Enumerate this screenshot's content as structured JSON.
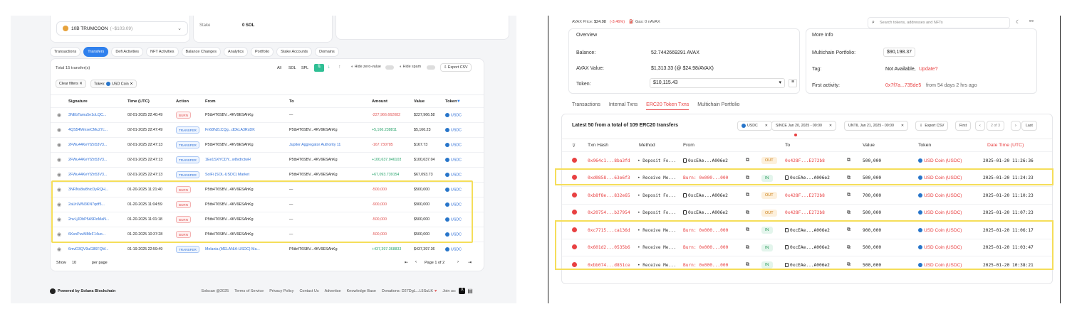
{
  "left": {
    "token_select": {
      "name": "10B TRUMCOON",
      "value": "(~$103.09)"
    },
    "stake": {
      "label": "Stake",
      "value": "0 SOL"
    },
    "tabs": [
      "Transactions",
      "Transfers",
      "Defi Activities",
      "NFT Activities",
      "Balance Changes",
      "Analytics",
      "Portfolio",
      "Stake Accounts",
      "Domains"
    ],
    "total": "Total 15 transfer(s)",
    "filters": [
      "All",
      "SOL",
      "SPL"
    ],
    "hide_zero": "Hide zero-value",
    "hide_spam": "Hide spam",
    "export": "Export CSV",
    "clear_filters": "Clear filters",
    "token_filter_label": "Token:",
    "token_filter_value": "USD Coin",
    "columns": [
      "Signature",
      "Time (UTC)",
      "Action",
      "From",
      "To",
      "Amount",
      "Value",
      "Token"
    ],
    "rows": [
      {
        "sig": "3NEbTamu5e1oLQC...",
        "time": "02-01-2025 22:40:49",
        "action": "BURN",
        "from": "P5tb4T6SBV...4KV9ESAhKg",
        "to": "—",
        "amount": "-227,966.662082",
        "value": "$227,966.58",
        "token": "USDC"
      },
      {
        "sig": "4QS54MmseCMu27c...",
        "time": "02-01-2025 22:47:49",
        "action": "TRANSFER",
        "from": "Fn68NZcCQg...dDkLA3RsDK",
        "to": "P5tb4T6SBV...4KV9ESAhKg",
        "amount": "+5,166.238811",
        "value": "$5,166.23",
        "token": "USDC"
      },
      {
        "sig": "2FWu44KeYfZn53V3...",
        "time": "02-01-2025 22:47:13",
        "action": "TRANSFER",
        "from": "P5tb4T6SBV...4KV9ESAhKg",
        "to": "Jupiter Aggregator Authority 11",
        "amount": "-167.730785",
        "value": "$167.73",
        "token": "USDC"
      },
      {
        "sig": "2FWu44KeYfZn53V3...",
        "time": "02-01-2025 22:47:13",
        "action": "TRANSFER",
        "from": "1Ee1SXYCDY...w8vdrctwH",
        "to": "P5tb4T6SBV...4KV9ESAhKg",
        "amount": "+100,637.046103",
        "value": "$100,637.04",
        "token": "USDC"
      },
      {
        "sig": "2FWu44KeYfZn53V3...",
        "time": "02-01-2025 22:47:13",
        "action": "TRANSFER",
        "from": "SolFi (SOL-USDC) Market",
        "to": "P5tb4T6SBV...4KV9ESAhKg",
        "amount": "+67,093.739154",
        "value": "$67,093.73",
        "token": "USDC"
      },
      {
        "sig": "3NRNs8w8hicDyRQH...",
        "time": "01-20-2025 11:21:40",
        "action": "BURN",
        "from": "P5tb4T6SBV...4KV9ESAhKg",
        "to": "—",
        "amount": "-500,000",
        "value": "$500,000",
        "token": "USDC"
      },
      {
        "sig": "2aUrLWN3KN7qdf5...",
        "time": "01-20-2025 11:04:59",
        "action": "BURN",
        "from": "P5tb4T6SBV...4KV9ESAhKg",
        "to": "—",
        "amount": "-900,000",
        "value": "$900,000",
        "token": "USDC"
      },
      {
        "sig": "2nvLjJDbP5A9RoMaN...",
        "time": "01-20-2025 11:01:18",
        "action": "BURN",
        "from": "P5tb4T6SBV...4KV9ESAhKg",
        "to": "—",
        "amount": "-500,000",
        "value": "$500,000",
        "token": "USDC"
      },
      {
        "sig": "6KsnPuvMMzF14uo...",
        "time": "01-20-2025 10:37:28",
        "action": "BURN",
        "from": "P5tb4T6SBV...4KV9ESAhKg",
        "to": "—",
        "amount": "-500,000",
        "value": "$500,000",
        "token": "USDC"
      },
      {
        "sig": "6mvD3QV9uG86FQM...",
        "time": "01-19-2025 22:59:49",
        "action": "TRANSFER",
        "from": "Melania (MELANIA-USDC) Ma...",
        "to": "P5tb4T6SBV...4KV9ESAhKg",
        "amount": "+437,397.368833",
        "value": "$437,397.36",
        "token": "USDC"
      }
    ],
    "show_label": "Show",
    "show_count": "10",
    "per_page": "per page",
    "page_info": "Page 1 of 2",
    "footer_brand": "Powered by Solana Blockchain",
    "footer_links": [
      "Solscan @2025",
      "Terms of Service",
      "Privacy Policy",
      "Contact Us",
      "Advertise",
      "Knowledge Base",
      "Donations: D27DgL...L5SuLK",
      "Join us:"
    ]
  },
  "right": {
    "avax_price_label": "AVAX Price:",
    "avax_price": "$24.98",
    "avax_change": "(-3.46%)",
    "gas": "Gas: 0 nAVAX",
    "search_placeholder": "Search tokens, addresses and NFTs",
    "overview_title": "Overview",
    "balance_label": "Balance:",
    "balance_value": "52.7442669291 AVAX",
    "avax_value_label": "AVAX Value:",
    "avax_value": "$1,313.33 (@ $24.98/AVAX)",
    "token_label": "Token:",
    "token_value": "$10,115.43",
    "more_info_title": "More Info",
    "multichain_label": "Multichain Portfolio:",
    "multichain_value": "$90,198.37",
    "tag_label": "Tag:",
    "tag_value": "Not Available,",
    "tag_update": "Update?",
    "first_activity_label": "First activity:",
    "first_activity_hash": "0x7f7a...735de5",
    "first_activity_ago": "from 54 days 2 hrs ago",
    "tabs": [
      "Transactions",
      "Internal Txns",
      "ERC20 Token Txns",
      "Multichain Portfolio"
    ],
    "latest": "Latest 50 from a total of 109 ERC20 transfers",
    "filter_token": "USDC",
    "filter_since": "SINCE Jan 20, 2025 - 00:00",
    "filter_until": "UNTIL Jan 21, 2025 - 00:00",
    "export": "Export CSV",
    "first": "First",
    "page": "2 of 3",
    "last": "Last",
    "columns": [
      "Txn Hash",
      "Method",
      "From",
      "To",
      "Value",
      "Token",
      "Date Time (UTC)"
    ],
    "rows": [
      {
        "hash": "0x964c1...8ba3fd",
        "method": "Deposit Fo...",
        "from": "0xcEAe...A006e2",
        "dir": "OUT",
        "to": "0x428F...E272b8",
        "value": "500,000",
        "token": "USD Coin (USDC)",
        "time": "2025-01-20 11:26:36"
      },
      {
        "hash": "0xd0858...63e6f3",
        "method": "Receive Me...",
        "from": "Burn: 0x000...000",
        "dir": "IN",
        "to": "0xcEAe...A006e2",
        "value": "500,000",
        "token": "USD Coin (USDC)",
        "time": "2025-01-20 11:24:23"
      },
      {
        "hash": "0xb8f8e...832e65",
        "method": "Deposit Fo...",
        "from": "0xcEAe...A006e2",
        "dir": "OUT",
        "to": "0x428F...E272b8",
        "value": "700,000",
        "token": "USD Coin (USDC)",
        "time": "2025-01-20 11:10:23"
      },
      {
        "hash": "0x20754...b27954",
        "method": "Deposit Fo...",
        "from": "0xcEAe...A006e2",
        "dir": "OUT",
        "to": "0x428F...E272b8",
        "value": "500,000",
        "token": "USD Coin (USDC)",
        "time": "2025-01-20 11:07:23"
      },
      {
        "hash": "0xc7715...ca136d",
        "method": "Receive Me...",
        "from": "Burn: 0x000...000",
        "dir": "IN",
        "to": "0xcEAe...A006e2",
        "value": "900,000",
        "token": "USD Coin (USDC)",
        "time": "2025-01-20 11:06:17"
      },
      {
        "hash": "0x601d2...0535b6",
        "method": "Receive Me...",
        "from": "Burn: 0x000...000",
        "dir": "IN",
        "to": "0xcEAe...A006e2",
        "value": "500,000",
        "token": "USD Coin (USDC)",
        "time": "2025-01-20 11:03:47"
      },
      {
        "hash": "0xbb074...d851ce",
        "method": "Receive Me...",
        "from": "Burn: 0x000...000",
        "dir": "IN",
        "to": "0xcEAe...A006e2",
        "value": "500,000",
        "token": "USD Coin (USDC)",
        "time": "2025-01-20 10:38:21"
      }
    ]
  }
}
